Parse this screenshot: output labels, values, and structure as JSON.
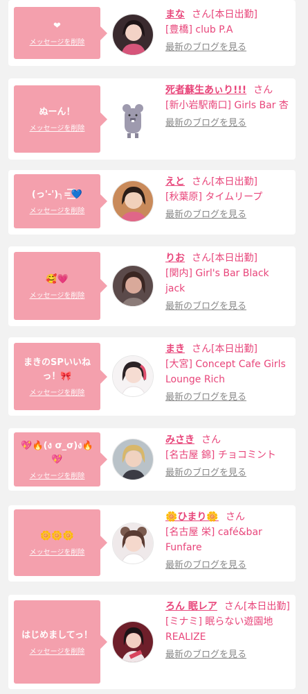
{
  "delete_label": "メッセージを削除",
  "san_label": "さん",
  "blog_label": "最新のブログを見る",
  "colors": {
    "bubble": "#f4a0ad",
    "accent": "#e8457a",
    "muted": "#888888",
    "background": "#f2f2f2"
  },
  "items": [
    {
      "message": "❤",
      "name": "まな",
      "suffix": "[本日出勤]",
      "shop": "[豊橋] club P.A",
      "avatar": "avatar-photo"
    },
    {
      "message": "ぬーん！",
      "name": "死者蘇生あぃり!!!",
      "suffix": "",
      "shop": "[新小岩駅南口] Girls Bar 杏",
      "avatar": "mascot-character-icon"
    },
    {
      "message": "(っ'-')╮=͟͟͞͞💙",
      "name": "えと",
      "suffix": "[本日出勤]",
      "shop": "[秋葉原] タイムリープ",
      "avatar": "avatar-photo"
    },
    {
      "message": "🥰💗",
      "name": "りお",
      "suffix": "[本日出勤]",
      "shop": "[関内] Girl's Bar Black jack",
      "avatar": "avatar-photo"
    },
    {
      "message": "まきのSPいいねっ！🎀",
      "name": "まき",
      "suffix": "[本日出勤]",
      "shop": "[大宮] Concept Cafe Girls Lounge Rich",
      "avatar": "avatar-photo"
    },
    {
      "message": "💖🔥(ง σ_σ)ง🔥💖",
      "name": "みさき",
      "suffix": "",
      "shop": "[名古屋 錦] チョコミント",
      "avatar": "avatar-photo"
    },
    {
      "message": "🌼🌼🌼",
      "name": "🌼ひまり🌼",
      "suffix": "",
      "shop": "[名古屋 栄] café&bar Funfare",
      "avatar": "avatar-photo"
    },
    {
      "message": "はじめましてっ！",
      "name": "ろん 眠レア",
      "suffix": "[本日出勤]",
      "shop": "[ミナミ] 眠らない遊園地 REALIZE",
      "avatar": "avatar-photo"
    }
  ]
}
